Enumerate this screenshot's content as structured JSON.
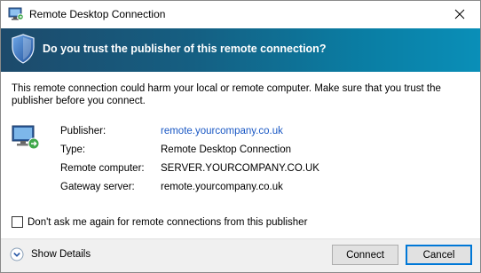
{
  "window": {
    "title": "Remote Desktop Connection",
    "icons": {
      "app": "remote-desktop-icon",
      "close": "close-icon"
    }
  },
  "banner": {
    "text": "Do you trust the publisher of this remote connection?",
    "icon": "shield-icon",
    "gradient_colors": [
      "#1d4a6b",
      "#0a8fb8"
    ]
  },
  "warning_text": "This remote connection could harm your local or remote computer. Make sure that you trust the publisher before you connect.",
  "details": {
    "icon": "computer-connection-icon",
    "rows": [
      {
        "label": "Publisher:",
        "value": "remote.yourcompany.co.uk",
        "link": true
      },
      {
        "label": "Type:",
        "value": "Remote Desktop Connection",
        "link": false
      },
      {
        "label": "Remote computer:",
        "value": "SERVER.YOURCOMPANY.CO.UK",
        "link": false
      },
      {
        "label": "Gateway server:",
        "value": "remote.yourcompany.co.uk",
        "link": false
      }
    ]
  },
  "checkbox": {
    "label": "Don't ask me again for remote connections from this publisher",
    "checked": false
  },
  "footer": {
    "show_details_label": "Show Details",
    "connect_label": "Connect",
    "cancel_label": "Cancel",
    "link_color": "#1a58c4"
  }
}
